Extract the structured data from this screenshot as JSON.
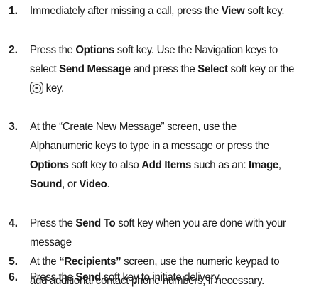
{
  "steps": [
    {
      "number": "1.",
      "lines": [
        [
          {
            "t": "Immediately after missing a call, press the ",
            "b": false
          },
          {
            "t": "View",
            "b": true
          },
          {
            "t": " soft key.",
            "b": false
          }
        ]
      ]
    },
    {
      "number": "2.",
      "lines": [
        [
          {
            "t": "Press the ",
            "b": false
          },
          {
            "t": "Options",
            "b": true
          },
          {
            "t": " soft key. Use the Navigation keys to",
            "b": false
          }
        ],
        [
          {
            "t": "select ",
            "b": false
          },
          {
            "t": "Send Message",
            "b": true
          },
          {
            "t": " and press the ",
            "b": false
          },
          {
            "t": "Select",
            "b": true
          },
          {
            "t": " soft key or the",
            "b": false
          }
        ],
        [
          {
            "icon": "select-key-icon"
          },
          {
            "t": " key.",
            "b": false
          }
        ]
      ]
    },
    {
      "number": "3.",
      "lines": [
        [
          {
            "t": "At the “Create New Message” screen, use the",
            "b": false
          }
        ],
        [
          {
            "t": "Alphanumeric keys to type in a message or press the",
            "b": false
          }
        ],
        [
          {
            "t": "Options",
            "b": true
          },
          {
            "t": " soft key to also ",
            "b": false
          },
          {
            "t": "Add Items",
            "b": true
          },
          {
            "t": " such as an: ",
            "b": false
          },
          {
            "t": "Image",
            "b": true
          },
          {
            "t": ",",
            "b": false
          }
        ],
        [
          {
            "t": "Sound",
            "b": true
          },
          {
            "t": ", or ",
            "b": false
          },
          {
            "t": "Video",
            "b": true
          },
          {
            "t": ".",
            "b": false
          }
        ]
      ]
    },
    {
      "number": "4.",
      "lines": [
        [
          {
            "t": "Press the ",
            "b": false
          },
          {
            "t": "Send To",
            "b": true
          },
          {
            "t": " soft key when you are done with your",
            "b": false
          }
        ],
        [
          {
            "t": "message",
            "b": false
          }
        ]
      ]
    },
    {
      "number": "5.",
      "lines": [
        [
          {
            "t": "At the ",
            "b": false
          },
          {
            "t": "“Recipients”",
            "b": true
          },
          {
            "t": " screen, use the numeric keypad to",
            "b": false
          }
        ],
        [
          {
            "t": "add additional contact phone numbers, if necessary.",
            "b": false
          }
        ]
      ]
    },
    {
      "number": "6.",
      "lines": [
        [
          {
            "t": "Press the ",
            "b": false
          },
          {
            "t": "Send",
            "b": true
          },
          {
            "t": " soft key to initiate delivery.",
            "b": false
          }
        ]
      ]
    }
  ]
}
